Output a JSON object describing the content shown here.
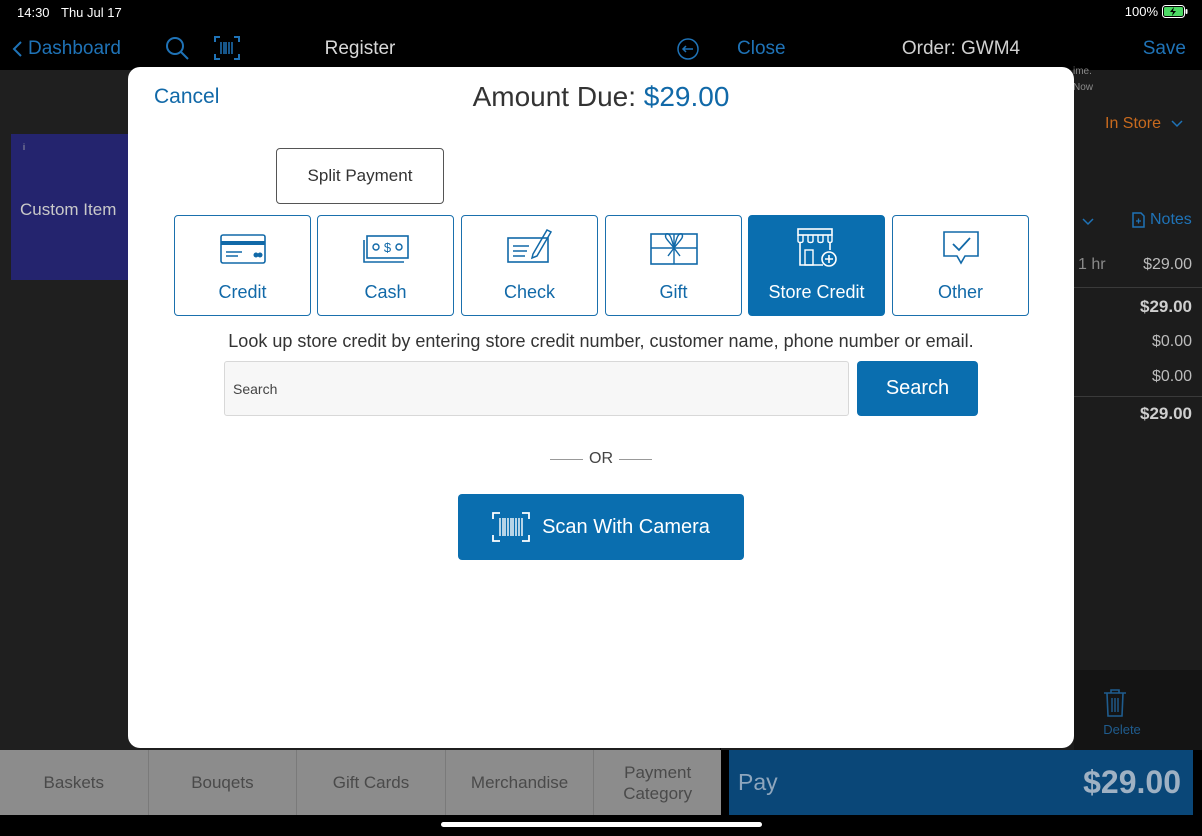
{
  "status_bar": {
    "time": "14:30",
    "date": "Thu Jul 17",
    "battery": "100%"
  },
  "register": {
    "back_label": "Dashboard",
    "title": "Register",
    "custom_tile": {
      "info": "i",
      "label": "Custom Item"
    }
  },
  "order": {
    "close_label": "Close",
    "title": "Order: GWM4",
    "save_label": "Save",
    "time_snip_1": "ime.",
    "time_snip_2": "Now",
    "fulfillment": "In Store",
    "notes_label": "Notes",
    "line_item": {
      "qty": "1 hr",
      "price": "$29.00"
    },
    "subtotal": "$29.00",
    "tax": "$0.00",
    "discount": "$0.00",
    "total": "$29.00",
    "delete_label": "Delete"
  },
  "bottom_bar": {
    "categories": [
      "Baskets",
      "Bouqets",
      "Gift Cards",
      "Merchandise",
      "Payment Category"
    ],
    "pay_label": "Pay",
    "pay_total": "$29.00"
  },
  "modal": {
    "cancel_label": "Cancel",
    "amount_due_label": "Amount Due: ",
    "amount_due_value": "$29.00",
    "split_payment_label": "Split Payment",
    "methods": [
      {
        "label": "Credit",
        "icon": "credit-card-icon"
      },
      {
        "label": "Cash",
        "icon": "cash-icon"
      },
      {
        "label": "Check",
        "icon": "check-icon"
      },
      {
        "label": "Gift",
        "icon": "gift-icon"
      },
      {
        "label": "Store Credit",
        "icon": "store-icon"
      },
      {
        "label": "Other",
        "icon": "other-icon"
      }
    ],
    "active_method": "Store Credit",
    "lookup_text": "Look up store credit by entering store credit number, customer name, phone number or email.",
    "search_placeholder": "Search",
    "search_button": "Search",
    "or_label": "OR",
    "scan_button": "Scan With Camera"
  },
  "colors": {
    "accent": "#0a6eaf",
    "link": "#1169a8",
    "orange": "#c86a1e"
  }
}
